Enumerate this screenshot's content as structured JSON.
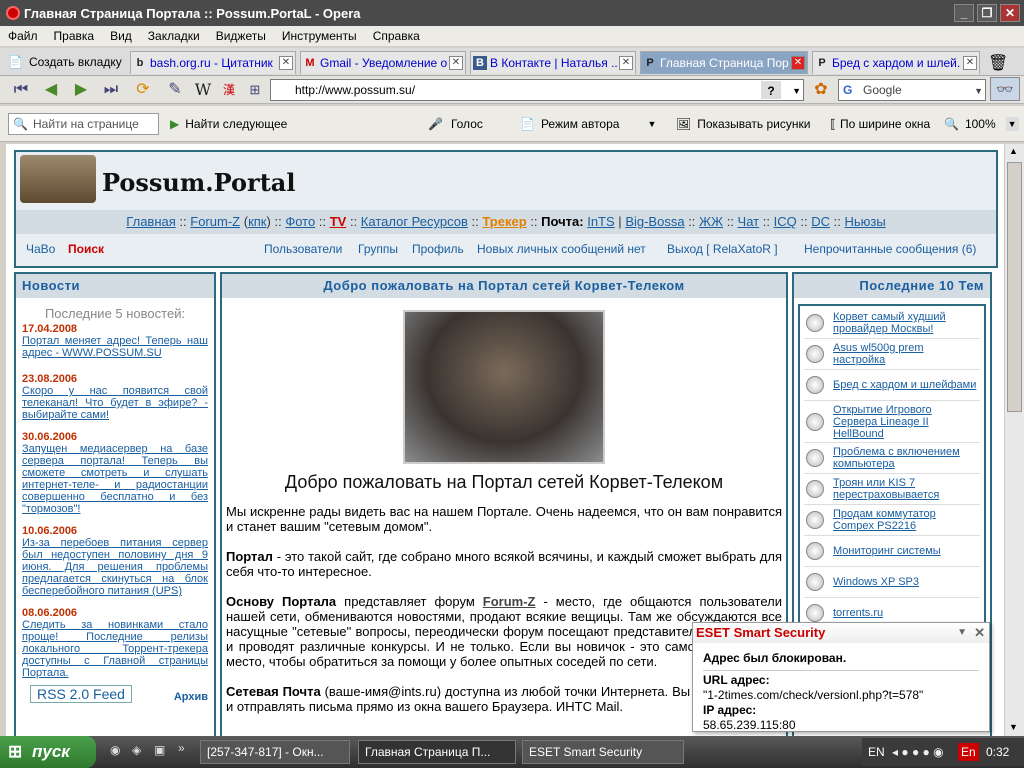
{
  "window": {
    "title": "Главная Страница Портала :: Possum.PortaL - Opera"
  },
  "menu": [
    "Файл",
    "Правка",
    "Вид",
    "Закладки",
    "Виджеты",
    "Инструменты",
    "Справка"
  ],
  "tabs": {
    "new_tab": "Создать вкладку",
    "items": [
      {
        "label": "bash.org.ru - Цитатник ...",
        "icon": "b"
      },
      {
        "label": "Gmail - Уведомление о...",
        "icon": "M"
      },
      {
        "label": "В Контакте | Наталья ...",
        "icon": "B"
      },
      {
        "label": "Главная Страница Пор...",
        "icon": "P",
        "active": true
      },
      {
        "label": "Бред с хардом и шлей...",
        "icon": "P"
      }
    ]
  },
  "address": {
    "url": "http://www.possum.su/",
    "search_engine": "Google"
  },
  "findbar": {
    "find_placeholder": "Найти на странице",
    "find_next": "Найти следующее",
    "voice": "Голос",
    "author_mode": "Режим автора",
    "show_images": "Показывать рисунки",
    "fit_width": "По ширине окна",
    "zoom": "100%"
  },
  "portal": {
    "logo_text": "Possum.Portal",
    "main_nav": [
      {
        "label": "Главная"
      },
      {
        "label": "Forum-Z"
      },
      {
        "label": "кпк"
      },
      {
        "label": "Фото"
      },
      {
        "label": "TV"
      },
      {
        "label": "Каталог Ресурсов"
      },
      {
        "label": "Трекер"
      },
      {
        "label": "Почта:"
      },
      {
        "label": "InTS"
      },
      {
        "label": "Big-Bossa"
      },
      {
        "label": "ЖЖ"
      },
      {
        "label": "Чат"
      },
      {
        "label": "ICQ"
      },
      {
        "label": "DC"
      },
      {
        "label": "Ньюзы"
      }
    ],
    "sub_nav_left": [
      "ЧаВо",
      "Поиск"
    ],
    "sub_nav_right": [
      "Пользователи",
      "Группы",
      "Профиль",
      "Новых личных сообщений нет",
      "Выход [ RelaXatoR ]",
      "Непрочитанные сообщения (6)"
    ]
  },
  "news": {
    "header": "Новости",
    "subheader": "Последние 5 новостей:",
    "items": [
      {
        "date": "17.04.2008",
        "text": "Портал меняет адрес! Теперь наш адрес - WWW.POSSUM.SU"
      },
      {
        "date": "23.08.2006",
        "text": "Скоро у нас появится свой телеканал! Что будет в эфире? - выбирайте сами!"
      },
      {
        "date": "30.06.2006",
        "text": "Запущен медиасервер на базе сервера портала! Теперь вы сможете смотреть и слушать интернет-теле- и радиостанции совершенно бесплатно и без \"тормозов\"!"
      },
      {
        "date": "10.06.2006",
        "text": "Из-за перебоев питания сервер был недоступен половину дня 9 июня. Для решения проблемы предлагается скинуться на блок бесперебойного питания (UPS)"
      },
      {
        "date": "08.06.2006",
        "text": "Следить за новинками стало проще! Последние релизы локального Торрент-трекера доступны с Главной страницы Портала."
      }
    ],
    "rss": "RSS 2.0 Feed",
    "archive": "Архив"
  },
  "center": {
    "header": "Добро пожаловать на Портал сетей Корвет-Телеком",
    "title": "Добро пожаловать на Портал сетей Корвет-Телеком",
    "p1": "Мы искренне рады видеть вас на нашем Портале. Очень надеемся, что он вам понравится и станет вашим \"сетевым домом\".",
    "p2_bold": "Портал",
    "p2": " - это такой сайт, где собрано много всякой всячины, и каждый сможет выбрать для себя что-то интересное.",
    "p3_bold": "Основу Портала",
    "p3_mid": " представляет форум ",
    "p3_link": "Forum-Z",
    "p3": " - место, где общаются пользователи нашей сети, обмениваются новостями, продают всякие вещицы. Там же обсуждаются все насущные \"сетевые\" вопросы, переодически форум посещают представители Провайдера и проводят различные конкурсы. И не только. Если вы новичок - это самое подходящее место, чтобы обратиться за помощи у более опытных соседей по сети.",
    "p4_bold": "Сетевая Почта",
    "p4": " (ваше-имя@ints.ru) доступна из любой точки Интернета. Вы можете читать и отправлять письма прямо из окна вашего Браузера. ИНТС Mail."
  },
  "topics": {
    "header": "Последние 10 Тем",
    "items": [
      "Корвет самый худший провайдер Москвы!",
      "Asus wl500g prem настройка",
      "Бред с хардом и шлейфами",
      "Открытие Игрового Сервера Lineage II HellBound",
      "Проблема с включением компьютера",
      "Троян или KIS 7 перестраховывается",
      "Продам коммутатор Compex PS2216",
      "Мониторинг системы",
      "Windows XP SP3",
      "torrents.ru"
    ]
  },
  "popup": {
    "title": "ESET Smart Security",
    "blocked": "Адрес был блокирован.",
    "url_label": "URL адрес:",
    "url": "\"1-2times.com/check/versionl.php?t=578\"",
    "ip_label": "IP адрес:",
    "ip": "58.65.239.115:80"
  },
  "taskbar": {
    "start": "пуск",
    "tasks": [
      "[257-347-817] - Окн...",
      "Главная Страница П...",
      "ESET Smart Security"
    ],
    "lang": "EN",
    "lang2": "En",
    "time": "0:32"
  }
}
